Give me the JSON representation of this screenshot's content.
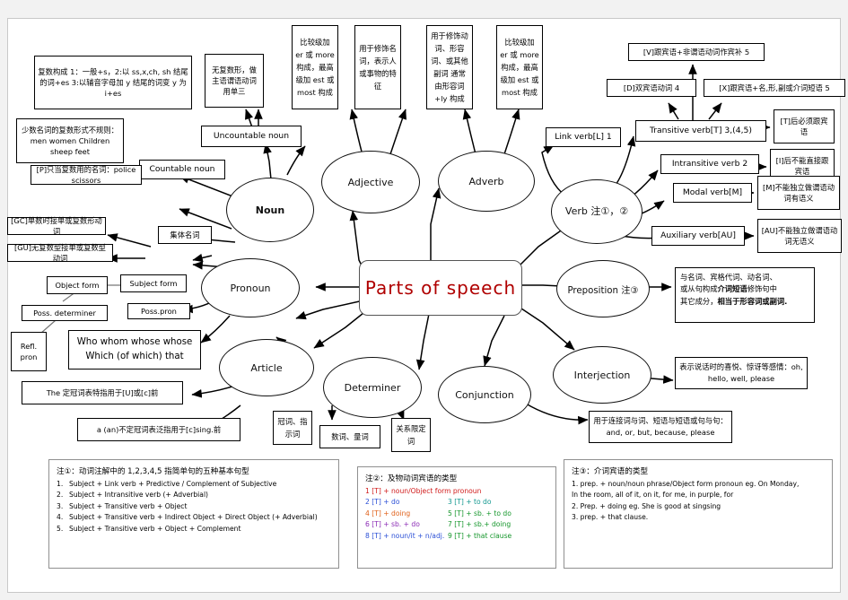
{
  "title": "Parts of speech",
  "center": {
    "label": "Parts  of  speech",
    "color": "#b00000"
  },
  "branches": {
    "noun": "Noun",
    "adjective": "Adjective",
    "adverb": "Adverb",
    "verb": "Verb  注①，②",
    "pronoun": "Pronoun",
    "article": "Article",
    "determiner": "Determiner",
    "conjunction": "Conjunction",
    "preposition": "Preposition 注③",
    "interjection": "Interjection"
  },
  "noun_cluster": {
    "plural_rules": "复数构成 1：一般+s，2:以 ss,x,ch, sh 结尾的词+es 3:以辅音字母加 y 结尾的词变 y 为 i+es",
    "irregular": "少数名词的复数形式不规则：men   women   Children   sheep   feet",
    "uncountable_note": "无复数形，做主语谓语动词用单三",
    "countable_noun": "Countable noun",
    "uncountable_noun": "Uncountable noun",
    "plural_only": "[P]只当复数用的名词：police    scissors",
    "collective_noun": "集体名词",
    "gc": "[GC]单数时接单或复数形动词",
    "gu": "[GU]无复数型接单或复数型动词"
  },
  "adjective_cluster": {
    "comparison": "比较级加 er 或 more 构成，最高级加 est 或 most 构成",
    "function": "用于修饰名词，表示人或事物的特征"
  },
  "adverb_cluster": {
    "function": "用于修饰动词、形容词、或其他副词 通常由形容词+ly 构成",
    "comparison": "比较级加 er 或 more 构成，最高级加 est 或 most 构成"
  },
  "verb_cluster": {
    "link_verb": "Link verb[L]  1",
    "transitive_verb": "Transitive verb[T]   3,(4,5)",
    "intransitive_verb": "Intransitive verb  2",
    "modal_verb": "Modal verb[M]",
    "auxiliary_verb": "Auxiliary verb[AU]",
    "v_note": "[V]跟宾语+非谓语动词作宾补 5",
    "d_note": "[D]双宾语动词 4",
    "x_note": "[X]跟宾语+名,形,副或介词短语 5",
    "t_note": "[T]后必须跟宾语",
    "i_note": "[I]后不能直接跟宾语",
    "m_note": "[M]不能独立做谓语动词有语义",
    "au_note": "[AU]不能独立做谓语动词无语义"
  },
  "pronoun_cluster": {
    "object_form": "Object  form",
    "subject_form": "Subject  form",
    "poss_determiner": "Poss. determiner",
    "poss_pron": "Poss.pron",
    "refl_pron": "Refl. pron",
    "relatives": "Who  whom  whose  whose Which (of which)    that"
  },
  "article_cluster": {
    "definite": "The 定冠词表特指用于[U]或[c]前",
    "indefinite": "a  (an)不定冠词表泛指用于[c]sing.前"
  },
  "determiner_cluster": {
    "box1": "冠词、指示词",
    "box2": "数词、量词",
    "box3": "关系限定词"
  },
  "conjunction_cluster": {
    "note": "用于连接词与词、短语与短语或句与句：and, or, but, because, please"
  },
  "preposition_cluster": {
    "note_plain1": "与名词、宾格代词、动名词、",
    "note_plain2": "或从句构成",
    "note_bold1": "介词短语",
    "note_plain3": "修饰句中",
    "note_plain4": "其它成分，",
    "note_bold2": "相当于形容词或副词."
  },
  "interjection_cluster": {
    "note": "表示说话时的喜悦、惊讶等感情：oh, hello, well, please"
  },
  "legends": {
    "one": {
      "title": "注①：动词注解中的 1,2,3,4,5 指简单句的五种基本句型",
      "rows": [
        {
          "n": "1.",
          "t": "Subject + Link verb + Predictive / Complement of Subjective"
        },
        {
          "n": "2.",
          "t": "Subject + Intransitive verb (+ Adverbial)"
        },
        {
          "n": "3.",
          "t": "Subject + Transitive verb + Object"
        },
        {
          "n": "4.",
          "t": "Subject + Transitive verb + Indirect Object + Direct Object (+ Adverbial)"
        },
        {
          "n": "5.",
          "t": "Subject + Transitive verb + Object + Complement"
        }
      ]
    },
    "two": {
      "title": "注②：及物动词宾语的类型",
      "rows": [
        {
          "a": "1 [T] + noun/Object form  pronoun",
          "ca": "c-red",
          "b": "",
          "cb": ""
        },
        {
          "a": "2 [T] + do",
          "ca": "c-blue",
          "b": "3 [T] + to do",
          "cb": "c-teal"
        },
        {
          "a": "4 [T] + doing",
          "ca": "c-orange",
          "b": "5 [T] + sb. + to do",
          "cb": "c-green"
        },
        {
          "a": "6 [T] + sb. + do",
          "ca": "c-purple",
          "b": "7 [T] + sb.+ doing",
          "cb": "c-green"
        },
        {
          "a": "8 [T] + noun/it + n/adj.",
          "ca": "c-blue",
          "b": "9 [T] + that clause",
          "cb": "c-green"
        }
      ]
    },
    "three": {
      "title": "注③：介词宾语的类型",
      "rows": [
        "1. prep. + noun/noun phrase/Object form pronoun eg. On Monday,",
        "    In the room, all of it, on it, for me, in purple, for",
        "2. Prep. + doing    eg. She is good at singsing",
        "3. prep. + that clause."
      ]
    }
  }
}
